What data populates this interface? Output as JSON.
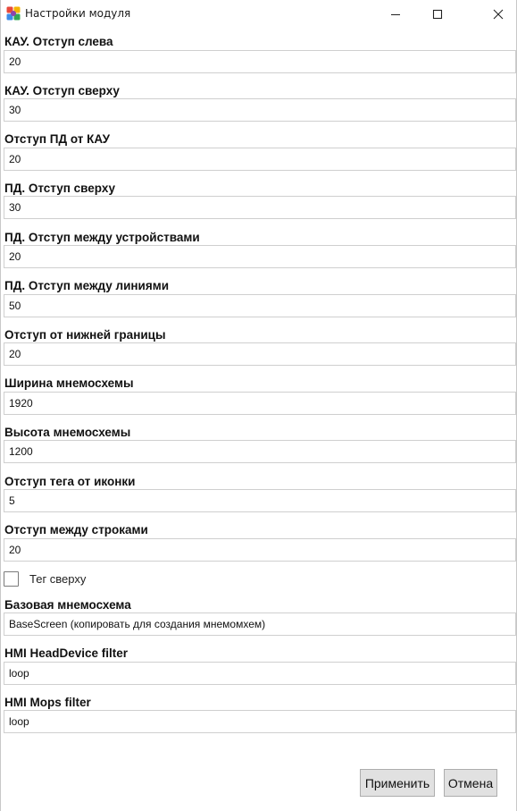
{
  "window": {
    "title": "Настройки модуля",
    "icon": "app-logo-icon",
    "controls": [
      "minimize-icon",
      "maximize-icon",
      "close-icon"
    ]
  },
  "fields": [
    {
      "label": "КАУ. Отступ слева",
      "value": "20"
    },
    {
      "label": "КАУ. Отступ сверху",
      "value": "30"
    },
    {
      "label": "Отступ ПД от КАУ",
      "value": "20"
    },
    {
      "label": "ПД. Отступ сверху",
      "value": "30"
    },
    {
      "label": "ПД. Отступ между устройствами",
      "value": "20"
    },
    {
      "label": "ПД. Отступ между линиями",
      "value": "50"
    },
    {
      "label": "Отступ от нижней границы",
      "value": "20"
    },
    {
      "label": "Ширина мнемосхемы",
      "value": "1920"
    },
    {
      "label": "Высота мнемосхемы",
      "value": "1200"
    },
    {
      "label": "Отступ тега от иконки",
      "value": "5"
    },
    {
      "label": "Отступ между строками",
      "value": "20"
    }
  ],
  "checkbox": {
    "label": "Тег сверху",
    "checked": false
  },
  "fields2": [
    {
      "label": "Базовая мнемосхема",
      "value": "BaseScreen (копировать для создания мнемомхем)"
    },
    {
      "label": "HMI HeadDevice filter",
      "value": "loop"
    },
    {
      "label": "HMI Mops filter",
      "value": "loop"
    }
  ],
  "buttons": {
    "apply": "Применить",
    "cancel": "Отмена"
  }
}
